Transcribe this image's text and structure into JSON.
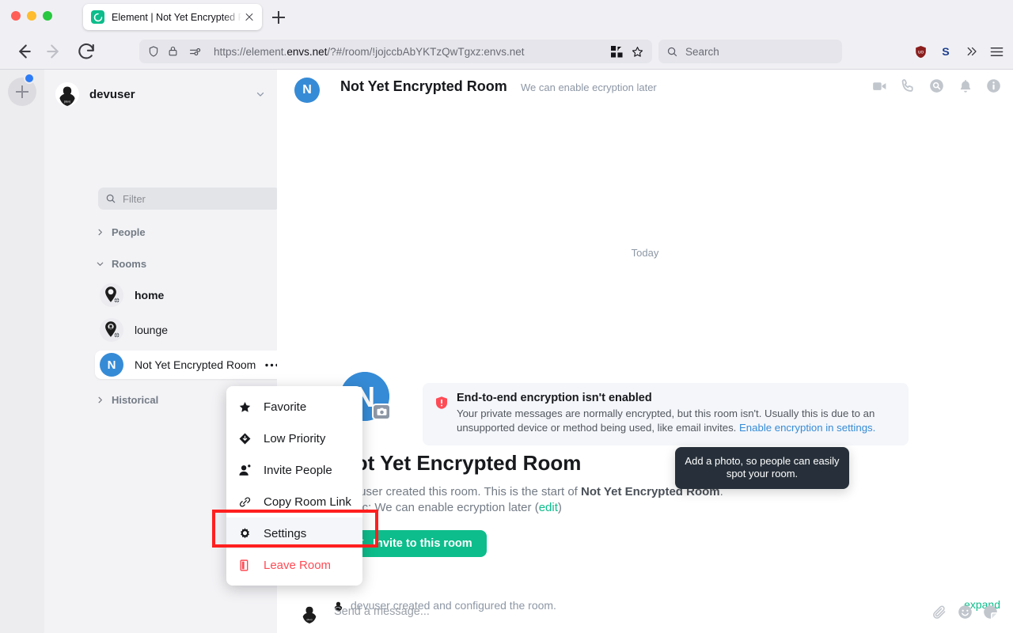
{
  "browser": {
    "tab": {
      "title": "Element | Not Yet Encrypted Roo",
      "favicon": "element-logo-icon",
      "close": "close-icon"
    },
    "new_tab_label": "new-tab-icon",
    "nav": {
      "back": "back-arrow-icon",
      "forward": "forward-arrow-icon",
      "reload": "reload-icon"
    },
    "url": {
      "prefix": "https://element.",
      "host": "envs.net",
      "path": "/?#/room/!jojccbAbYKTzQwTgxz:envs.net",
      "full": "https://element.envs.net/?#/room/!jojccbAbYKTzQwTgxz:envs.net"
    },
    "search": {
      "placeholder": "Search"
    },
    "extensions": [
      "ublock-origin-icon",
      "s-extension-icon"
    ],
    "overflow_label": "overflow-chevrons-icon",
    "menu_label": "hamburger-menu-icon"
  },
  "space_panel": {
    "add_label": "add-space-icon",
    "badge": true
  },
  "room_list": {
    "user": {
      "name": "devuser",
      "avatar": "devuser-avatar",
      "chevron": "chevron-down-icon"
    },
    "filter": {
      "placeholder": "Filter",
      "icon": "search-icon"
    },
    "explore": {
      "icon": "explore-compass-icon"
    },
    "sections": [
      {
        "name": "People",
        "expanded": false,
        "add_label": "add-person-icon"
      },
      {
        "name": "Rooms",
        "expanded": true,
        "add_label": "add-room-icon"
      },
      {
        "name": "Historical",
        "expanded": false,
        "add_label": ""
      }
    ],
    "rooms": [
      {
        "name": "home",
        "avatar_type": "pin",
        "bold": true,
        "unread": true,
        "selected": false
      },
      {
        "name": "lounge",
        "avatar_type": "pin",
        "bold": false,
        "unread": false,
        "selected": false
      },
      {
        "name": "Not Yet Encrypted Room",
        "avatar_type": "letter",
        "letter": "N",
        "bold": false,
        "unread": false,
        "selected": true,
        "options_icon": "ellipsis-icon",
        "notify_icon": "bell-icon"
      }
    ]
  },
  "room_header": {
    "avatar_letter": "N",
    "name": "Not Yet Encrypted Room",
    "topic": "We can enable ecryption later",
    "icons": [
      "video-call-icon",
      "voice-call-icon",
      "room-search-icon",
      "notifications-bell-icon",
      "room-info-icon"
    ]
  },
  "timeline": {
    "date_separator": "Today",
    "e2e_warning": {
      "title": "End-to-end encryption isn't enabled",
      "body": "Your private messages are normally encrypted, but this room isn't. Usually this is due to an unsupported device or method being used, like email invites.",
      "link": "Enable encryption in settings.",
      "icon": "warning-shield-icon"
    },
    "intro": {
      "avatar_camera_icon": "camera-icon",
      "title": "Not Yet Encrypted Room",
      "line1_prefix": "devuser created this room. This is the start of ",
      "line1_room": "Not Yet Encrypted Room",
      "line1_suffix": ".",
      "line2_prefix": "Topic: We can enable ecryption later (",
      "line2_edit": "edit",
      "line2_suffix": ")",
      "invite_button": "Invite to this room",
      "invite_icon": "invite-person-icon"
    },
    "tooltip": "Add a photo, so people can easily spot your room.",
    "event": {
      "text": "devuser created and configured the room.",
      "avatar": "devuser-avatar",
      "expand": "expand"
    }
  },
  "composer": {
    "placeholder": "Send a message...",
    "avatar": "devuser-avatar",
    "icons": [
      "attachment-icon",
      "emoji-icon",
      "sticker-icon"
    ]
  },
  "context_menu": {
    "items": [
      {
        "label": "Favorite",
        "icon": "star-icon",
        "highlighted": false,
        "danger": false
      },
      {
        "label": "Low Priority",
        "icon": "low-priority-icon",
        "highlighted": false,
        "danger": false
      },
      {
        "label": "Invite People",
        "icon": "invite-people-icon",
        "highlighted": false,
        "danger": false
      },
      {
        "label": "Copy Room Link",
        "icon": "link-icon",
        "highlighted": false,
        "danger": false
      },
      {
        "label": "Settings",
        "icon": "gear-icon",
        "highlighted": true,
        "danger": false
      },
      {
        "label": "Leave Room",
        "icon": "leave-room-icon",
        "highlighted": false,
        "danger": true
      }
    ]
  },
  "annotation": {
    "highlight_color": "#ff1f1f",
    "target": "Settings"
  },
  "colors": {
    "accent": "#0dbd8b",
    "room_avatar": "#368bd6",
    "danger": "#ff4b55",
    "link": "#368bd6",
    "highlight": "#ff1f1f"
  }
}
